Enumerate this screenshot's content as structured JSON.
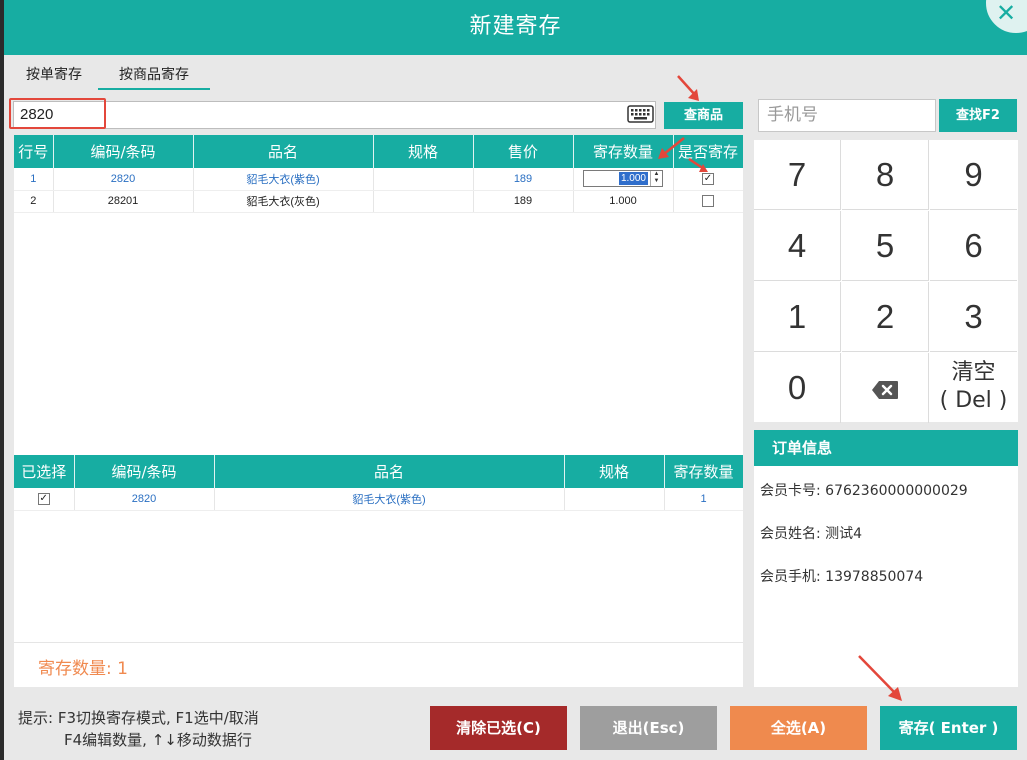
{
  "window": {
    "title": "新建寄存"
  },
  "tabs": [
    {
      "label": "按单寄存"
    },
    {
      "label": "按商品寄存"
    }
  ],
  "search": {
    "value": "2820",
    "button": "查商品"
  },
  "top_table": {
    "headers": [
      "行号",
      "编码/条码",
      "品名",
      "规格",
      "售价",
      "寄存数量",
      "是否寄存"
    ],
    "rows": [
      {
        "line": "1",
        "code": "2820",
        "name": "貂毛大衣(紫色)",
        "spec": "",
        "price": "189",
        "qty": "1.000",
        "checked": true
      },
      {
        "line": "2",
        "code": "28201",
        "name": "貂毛大衣(灰色)",
        "spec": "",
        "price": "189",
        "qty": "1.000",
        "checked": false
      }
    ]
  },
  "bottom_table": {
    "headers": [
      "已选择",
      "编码/条码",
      "品名",
      "规格",
      "寄存数量"
    ],
    "rows": [
      {
        "checked": true,
        "code": "2820",
        "name": "貂毛大衣(紫色)",
        "spec": "",
        "qty": "1"
      }
    ]
  },
  "total": {
    "label": "寄存数量: 1"
  },
  "phone": {
    "placeholder": "手机号",
    "button": "查找F2"
  },
  "keypad": {
    "keys": [
      "7",
      "8",
      "9",
      "4",
      "5",
      "6",
      "1",
      "2",
      "3",
      "0"
    ],
    "clear_line1": "清空",
    "clear_line2": "( Del )"
  },
  "order": {
    "title": "订单信息",
    "card_no": "会员卡号:  6762360000000029",
    "name": "会员姓名:  测试4",
    "phone": "会员手机:  13978850074"
  },
  "hint": {
    "line1": "提示: F3切换寄存模式, F1选中/取消",
    "line2": "F4编辑数量, ↑↓移动数据行"
  },
  "buttons": {
    "clear": "清除已选(C)",
    "exit": "退出(Esc)",
    "select_all": "全选(A)",
    "deposit": "寄存( Enter )"
  },
  "colors": {
    "accent": "#17ada2",
    "danger": "#a52a2a",
    "muted": "#9e9e9e",
    "orange": "#ef8a4e",
    "annotation": "#e3473b"
  }
}
